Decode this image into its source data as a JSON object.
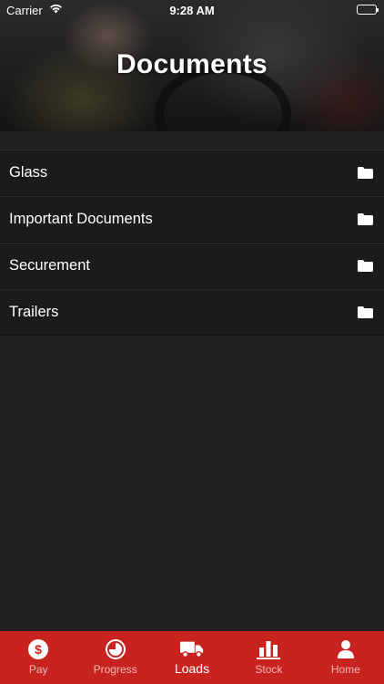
{
  "status_bar": {
    "carrier": "Carrier",
    "time": "9:28 AM"
  },
  "header": {
    "title": "Documents"
  },
  "folders": [
    {
      "label": "Glass",
      "icon": "folder-icon"
    },
    {
      "label": "Important Documents",
      "icon": "folder-icon"
    },
    {
      "label": "Securement",
      "icon": "folder-icon"
    },
    {
      "label": "Trailers",
      "icon": "folder-icon"
    }
  ],
  "tabs": [
    {
      "label": "Pay",
      "icon": "dollar-coin-icon",
      "active": false
    },
    {
      "label": "Progress",
      "icon": "progress-pie-icon",
      "active": false
    },
    {
      "label": "Loads",
      "icon": "truck-icon",
      "active": true
    },
    {
      "label": "Stock",
      "icon": "bar-chart-icon",
      "active": false
    },
    {
      "label": "Home",
      "icon": "person-icon",
      "active": false
    }
  ],
  "colors": {
    "tab_bar": "#c9231f",
    "background": "#222222",
    "row": "#1b1b1b"
  }
}
